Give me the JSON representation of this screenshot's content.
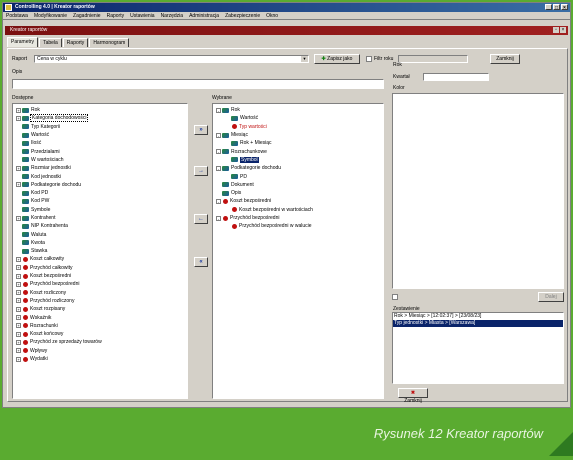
{
  "window": {
    "title": "Controlling 4.0 | Kreator raportów"
  },
  "menu": [
    "Podstawa",
    "Modyfikowanie",
    "Zagadnienie",
    "Raporty",
    "Ustawienia",
    "Narzędzia",
    "Administracja",
    "Zabezpieczenie",
    "Okno"
  ],
  "subwindow": {
    "title": "Kreator raportów"
  },
  "tabs": [
    "Parametry",
    "Tabela",
    "Raporty",
    "Harmonogram"
  ],
  "raport": {
    "label": "Raport",
    "value": "Cena w cyklu",
    "zapisz_label": "Zapisz jako",
    "filtr_label": "Filtr roku",
    "zamknij_label": "Zamknij"
  },
  "opis": {
    "label": "Opis"
  },
  "right": {
    "rok_label": "Rok",
    "kwartal_label": "Kwartał",
    "kolor_label": "Kolor",
    "button_label": "Dalej",
    "zestaw_label": "Zestawienie",
    "zestaw_rows": [
      "Rok > Miesiąc > [12:02:37] > [23/08/23]",
      "Typ jednostki > Miasta > [Warszawa]"
    ],
    "close_label": "Zamknij"
  },
  "dostepne": {
    "label": "Dostępne",
    "items": [
      {
        "exp": "+",
        "icon": "blue",
        "text": "Rok",
        "red": false
      },
      {
        "exp": "+",
        "icon": "blue",
        "text": "Kategoria dochodowości",
        "red": false,
        "focus": true
      },
      {
        "exp": "",
        "icon": "blue",
        "text": "Typ Kategorii",
        "red": false
      },
      {
        "exp": "",
        "icon": "blue",
        "text": "Wartość",
        "red": false
      },
      {
        "exp": "",
        "icon": "blue",
        "text": "Ilość",
        "red": false
      },
      {
        "exp": "",
        "icon": "blue",
        "text": "Przedziałami",
        "red": false
      },
      {
        "exp": "",
        "icon": "blue",
        "text": "W wartościach",
        "red": false
      },
      {
        "exp": "+",
        "icon": "blue",
        "text": "Rozmiar jednostki",
        "red": false
      },
      {
        "exp": "",
        "icon": "blue",
        "text": "Kod jednostki",
        "red": false
      },
      {
        "exp": "+",
        "icon": "blue",
        "text": "Podkategorie dochodu",
        "red": false
      },
      {
        "exp": "",
        "icon": "blue",
        "text": "Kod PD",
        "red": false
      },
      {
        "exp": "",
        "icon": "blue",
        "text": "Kod PW",
        "red": false
      },
      {
        "exp": "",
        "icon": "blue",
        "text": "Symbole",
        "red": false
      },
      {
        "exp": "+",
        "icon": "blue",
        "text": "Kontrahent",
        "red": false
      },
      {
        "exp": "",
        "icon": "blue",
        "text": "NIP Kontrahenta",
        "red": false
      },
      {
        "exp": "",
        "icon": "blue",
        "text": "Waluta",
        "red": false
      },
      {
        "exp": "",
        "icon": "blue",
        "text": "Kwota",
        "red": false
      },
      {
        "exp": "",
        "icon": "blue",
        "text": "Stawka",
        "red": false
      },
      {
        "exp": "+",
        "icon": "red",
        "text": "Koszt całkowity",
        "red": false
      },
      {
        "exp": "+",
        "icon": "red",
        "text": "Przychód całkowity",
        "red": false
      },
      {
        "exp": "+",
        "icon": "red",
        "text": "Koszt bezpośredni",
        "red": false
      },
      {
        "exp": "+",
        "icon": "red",
        "text": "Przychód bezpośredni",
        "red": false
      },
      {
        "exp": "+",
        "icon": "red",
        "text": "Koszt rozliczony",
        "red": false
      },
      {
        "exp": "+",
        "icon": "red",
        "text": "Przychód rozliczony",
        "red": false
      },
      {
        "exp": "+",
        "icon": "red",
        "text": "Koszt rozpisany",
        "red": false
      },
      {
        "exp": "+",
        "icon": "red",
        "text": "Wskaźnik",
        "red": false
      },
      {
        "exp": "+",
        "icon": "red",
        "text": "Rozrachunki",
        "red": false
      },
      {
        "exp": "+",
        "icon": "red",
        "text": "Koszt końcowy",
        "red": false
      },
      {
        "exp": "+",
        "icon": "red",
        "text": "Przychód ze sprzedaży towarów",
        "red": false
      },
      {
        "exp": "+",
        "icon": "red",
        "text": "Wpływy",
        "red": false
      },
      {
        "exp": "+",
        "icon": "red",
        "text": "Wydatki",
        "red": false
      }
    ]
  },
  "wybrane": {
    "label": "Wybrane",
    "items": [
      {
        "exp": "-",
        "indent": 0,
        "icon": "blue",
        "text": "Rok",
        "red": false
      },
      {
        "exp": "",
        "indent": 1,
        "icon": "blue",
        "text": "Wartość",
        "red": false
      },
      {
        "exp": "",
        "indent": 1,
        "icon": "red",
        "text": "Typ wartości",
        "red": true
      },
      {
        "exp": "-",
        "indent": 0,
        "icon": "blue",
        "text": "Miesiąc",
        "red": false
      },
      {
        "exp": "",
        "indent": 1,
        "icon": "blue",
        "text": "Rok + Miesiąc",
        "red": false
      },
      {
        "exp": "-",
        "indent": 0,
        "icon": "blue",
        "text": "Rozrachunkowe",
        "red": false
      },
      {
        "exp": "",
        "indent": 1,
        "icon": "blue",
        "text": "Symbol",
        "red": false,
        "sel": true
      },
      {
        "exp": "-",
        "indent": 0,
        "icon": "blue",
        "text": "Podkategorie dochodu",
        "red": false
      },
      {
        "exp": "",
        "indent": 1,
        "icon": "blue",
        "text": "PD",
        "red": false
      },
      {
        "exp": "",
        "indent": 0,
        "icon": "blue",
        "text": "Dokument",
        "red": false
      },
      {
        "exp": "",
        "indent": 0,
        "icon": "blue",
        "text": "Opis",
        "red": false
      },
      {
        "exp": "-",
        "indent": 0,
        "icon": "red",
        "text": "Koszt bezpośredni",
        "red": false
      },
      {
        "exp": "",
        "indent": 1,
        "icon": "red",
        "text": "Koszt bezpośredni w wartościach",
        "red": false
      },
      {
        "exp": "-",
        "indent": 0,
        "icon": "red",
        "text": "Przychód bezpośredni",
        "red": false
      },
      {
        "exp": "",
        "indent": 1,
        "icon": "red",
        "text": "Przychód bezpośredni w walucie",
        "red": false
      }
    ]
  },
  "arrows": [
    "»",
    "→",
    "←",
    "«"
  ],
  "caption": "Rysunek 12 Kreator raportów"
}
